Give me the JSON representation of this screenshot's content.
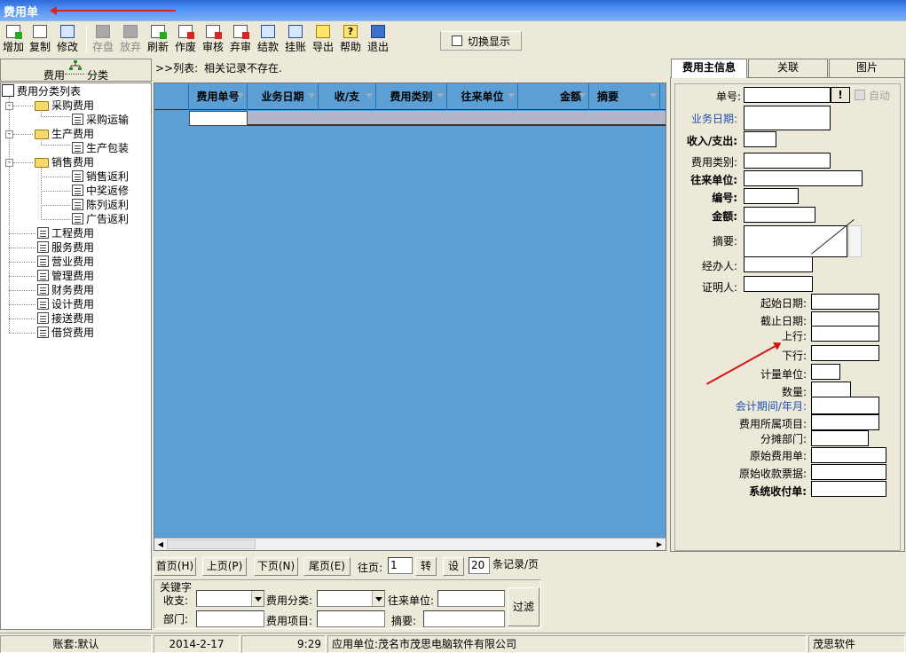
{
  "window": {
    "title": "费用单"
  },
  "toolbar": {
    "buttons": [
      {
        "label": "增加",
        "icon": "add-icon"
      },
      {
        "label": "复制",
        "icon": "copy-icon"
      },
      {
        "label": "修改",
        "icon": "edit-icon"
      },
      {
        "label": "存盘",
        "icon": "save-icon",
        "disabled": true
      },
      {
        "label": "放弃",
        "icon": "discard-icon",
        "disabled": true
      },
      {
        "label": "刷新",
        "icon": "refresh-icon"
      },
      {
        "label": "作废",
        "icon": "void-icon"
      },
      {
        "label": "审核",
        "icon": "approve-icon"
      },
      {
        "label": "弃审",
        "icon": "unapprove-icon"
      },
      {
        "label": "结款",
        "icon": "settle-icon"
      },
      {
        "label": "挂账",
        "icon": "ledger-icon"
      },
      {
        "label": "导出",
        "icon": "export-icon"
      },
      {
        "label": "帮助",
        "icon": "help-icon"
      },
      {
        "label": "退出",
        "icon": "exit-icon"
      }
    ],
    "switch_display_label": "切换显示"
  },
  "left": {
    "header_text_left": "费用",
    "header_text_right": "分类",
    "tree": {
      "root": "费用分类列表",
      "groups": [
        {
          "label": "采购费用",
          "children": [
            "采购运输"
          ]
        },
        {
          "label": "生产费用",
          "children": [
            "生产包装"
          ]
        },
        {
          "label": "销售费用",
          "children": [
            "销售返利",
            "中奖返修",
            "陈列返利",
            "广告返利"
          ]
        }
      ],
      "leaves": [
        "工程费用",
        "服务费用",
        "营业费用",
        "管理费用",
        "财务费用",
        "设计费用",
        "接送费用",
        "借贷费用"
      ]
    }
  },
  "list": {
    "prefix": ">>列表:",
    "message": "相关记录不存在.",
    "columns": [
      "费用单号",
      "业务日期",
      "收/支",
      "费用类别",
      "往来单位",
      "金额",
      "摘要"
    ]
  },
  "pager": {
    "first": "首页(H)",
    "prev": "上页(P)",
    "next": "下页(N)",
    "last": "尾页(E)",
    "goto_label": "往页:",
    "goto_value": "1",
    "go_button": "转",
    "set_button": "设",
    "per_page_value": "20",
    "per_page_suffix": "条记录/页"
  },
  "filter": {
    "group_label": "关键字",
    "income_label": "收支:",
    "category_label": "费用分类:",
    "partner_label": "往来单位:",
    "dept_label": "部门:",
    "item_label": "费用项目:",
    "summary_label": "摘要:",
    "filter_button": "过滤"
  },
  "right": {
    "tabs": [
      "费用主信息",
      "关联",
      "图片"
    ],
    "auto_label": "自动",
    "fields": {
      "doc_no": "单号:",
      "biz_date": "业务日期:",
      "in_out": "收入/支出:",
      "category": "费用类别:",
      "partner": "往来单位:",
      "code": "编号:",
      "amount": "金额:",
      "summary": "摘要:",
      "handler": "经办人:",
      "witness": "证明人:",
      "start_date": "起始日期:",
      "end_date": "截止日期:",
      "up_line": "上行:",
      "down_line": "下行:",
      "unit": "计量单位:",
      "quantity": "数量:",
      "period": "会计期间/年月:",
      "project": "费用所属项目:",
      "dept": "分摊部门:",
      "orig_doc": "原始费用单:",
      "orig_receipt": "原始收款票据:",
      "sys_receipt": "系统收付单:"
    }
  },
  "status": {
    "account": "账套:默认",
    "date": "2014-2-17",
    "time": "9:29",
    "company": "应用单位:茂名市茂思电脑软件有限公司",
    "vendor": "茂思软件"
  }
}
